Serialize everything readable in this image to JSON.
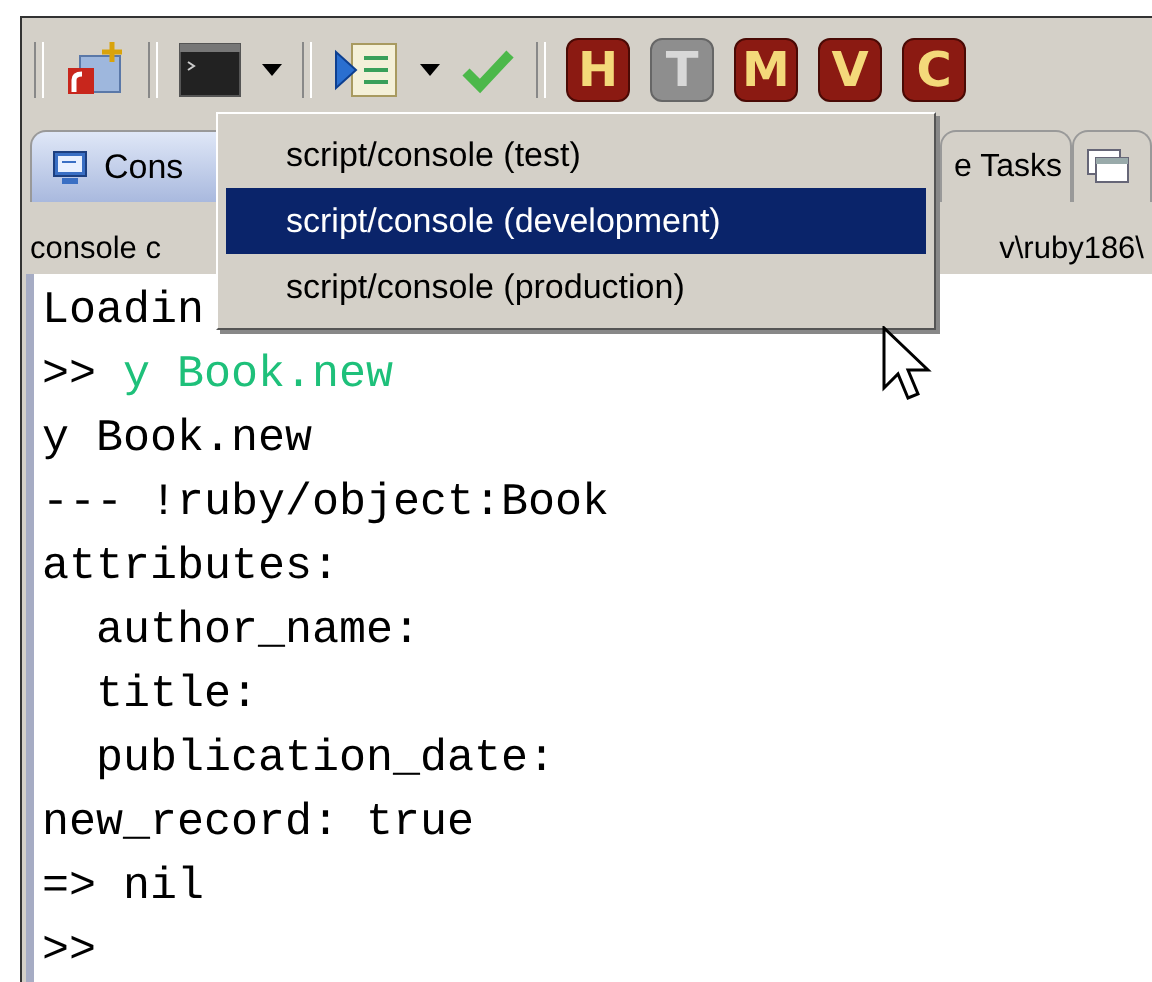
{
  "toolbar": {
    "badges": [
      {
        "letter": "H",
        "disabled": false
      },
      {
        "letter": "T",
        "disabled": true
      },
      {
        "letter": "M",
        "disabled": false
      },
      {
        "letter": "V",
        "disabled": false
      },
      {
        "letter": "C",
        "disabled": false
      }
    ]
  },
  "tabs": [
    {
      "kind": "console",
      "label": "Cons",
      "selected": true
    },
    {
      "kind": "tasks",
      "label": "e Tasks",
      "selected": false
    },
    {
      "kind": "window",
      "selected": false
    }
  ],
  "console": {
    "path_left": "console c",
    "path_right": "v\\ruby186\\",
    "lines": [
      {
        "kind": "output",
        "text": "Loadin"
      },
      {
        "kind": "input",
        "prompt": ">>",
        "text": "y Book.new"
      },
      {
        "kind": "output",
        "text": "y Book.new"
      },
      {
        "kind": "output",
        "text": "--- !ruby/object:Book"
      },
      {
        "kind": "output",
        "text": "attributes:"
      },
      {
        "kind": "output",
        "text": "  author_name:"
      },
      {
        "kind": "output",
        "text": "  title:"
      },
      {
        "kind": "output",
        "text": "  publication_date:"
      },
      {
        "kind": "output",
        "text": "new_record: true"
      },
      {
        "kind": "output",
        "text": "=> nil"
      },
      {
        "kind": "prompt",
        "prompt": ">>"
      }
    ]
  },
  "menu": {
    "items": [
      {
        "label": "script/console (test)",
        "selected": false
      },
      {
        "label": "script/console (development)",
        "selected": true
      },
      {
        "label": "script/console (production)",
        "selected": false
      }
    ]
  }
}
